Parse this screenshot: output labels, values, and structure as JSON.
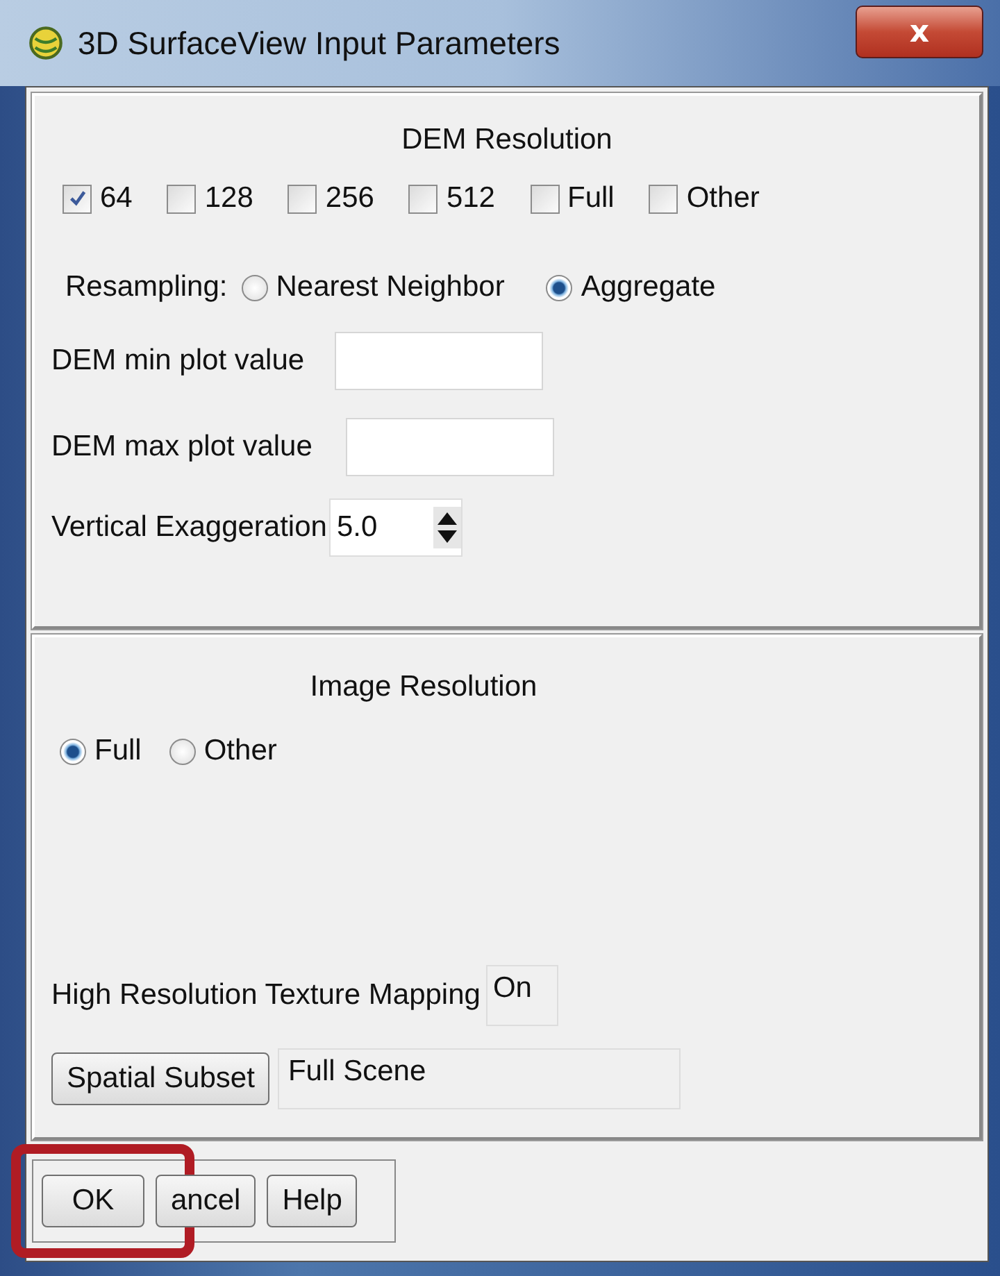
{
  "window": {
    "title": "3D SurfaceView Input Parameters",
    "close": "x"
  },
  "dem_resolution": {
    "title": "DEM Resolution",
    "options": [
      {
        "label": "64",
        "checked": true
      },
      {
        "label": "128",
        "checked": false
      },
      {
        "label": "256",
        "checked": false
      },
      {
        "label": "512",
        "checked": false
      },
      {
        "label": "Full",
        "checked": false
      },
      {
        "label": "Other",
        "checked": false
      }
    ],
    "resampling": {
      "label": "Resampling:",
      "options": [
        {
          "label": "Nearest Neighbor",
          "selected": false
        },
        {
          "label": "Aggregate",
          "selected": true
        }
      ]
    },
    "min_plot": {
      "label": "DEM min plot value"
    },
    "max_plot": {
      "label": "DEM max plot value"
    },
    "exaggeration": {
      "label": "Vertical Exaggeration",
      "value": "5.0"
    }
  },
  "image_resolution": {
    "title": "Image Resolution",
    "options": [
      {
        "label": "Full",
        "selected": true
      },
      {
        "label": "Other",
        "selected": false
      }
    ],
    "texture": {
      "label": "High Resolution Texture Mapping",
      "value": "On"
    },
    "subset": {
      "button": "Spatial Subset",
      "value": "Full Scene"
    }
  },
  "buttons": [
    {
      "label": "OK",
      "highlighted": true
    },
    {
      "label": "ancel",
      "highlighted": false
    },
    {
      "label": "Help",
      "highlighted": false
    }
  ]
}
